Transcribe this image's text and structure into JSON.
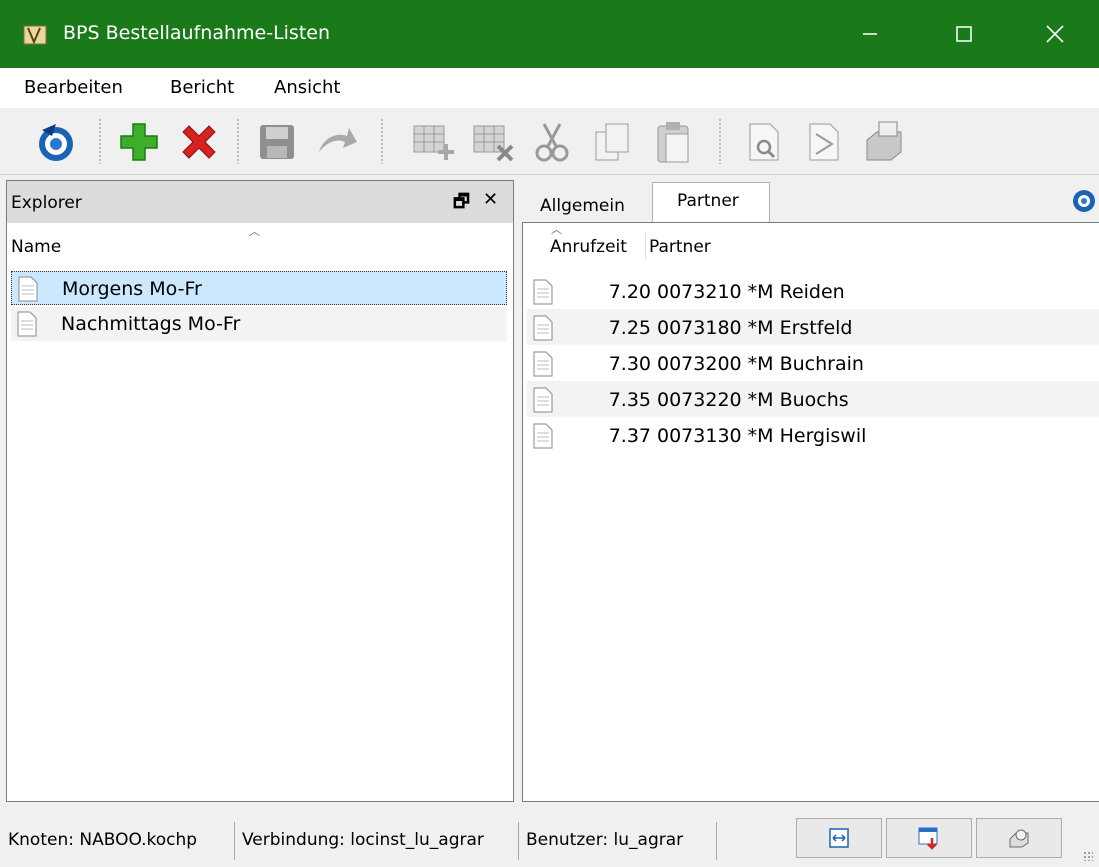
{
  "window": {
    "title": "BPS Bestellaufnahme-Listen",
    "title_bar_color": "#1a7a1a",
    "controls": {
      "minimize": "minimize-icon",
      "maximize": "maximize-icon",
      "close": "close-icon"
    }
  },
  "menu": [
    "Bearbeiten",
    "Bericht",
    "Ansicht"
  ],
  "toolbar": {
    "icons": [
      "refresh-icon",
      "add-icon",
      "delete-icon",
      "save-icon",
      "undo-icon",
      "grid-add-icon",
      "grid-delete-icon",
      "cut-icon",
      "copy-icon",
      "paste-icon",
      "preview-icon",
      "pdf-icon",
      "print-icon"
    ]
  },
  "explorer": {
    "title": "Explorer",
    "column": "Name",
    "items": [
      {
        "label": "Morgens Mo-Fr",
        "selected": true
      },
      {
        "label": "Nachmittags Mo-Fr",
        "selected": false
      }
    ],
    "selection_color": "#cce8ff"
  },
  "detail": {
    "tabs": [
      "Allgemein",
      "Partner"
    ],
    "active_tab": "Partner",
    "columns": [
      "Anrufzeit",
      "Partner"
    ],
    "rows": [
      {
        "time": "7.20",
        "partner": "0073210 *M Reiden"
      },
      {
        "time": "7.25",
        "partner": "0073180 *M Erstfeld"
      },
      {
        "time": "7.30",
        "partner": "0073200 *M Buchrain"
      },
      {
        "time": "7.35",
        "partner": "0073220 *M Buochs"
      },
      {
        "time": "7.37",
        "partner": "0073130 *M Hergiswil"
      }
    ]
  },
  "status": {
    "node": "Knoten: NABOO.kochp",
    "connection": "Verbindung: locinst_lu_agrar",
    "user": "Benutzer: lu_agrar",
    "buttons": [
      "fit-width-icon",
      "export-icon",
      "print-settings-icon"
    ]
  }
}
